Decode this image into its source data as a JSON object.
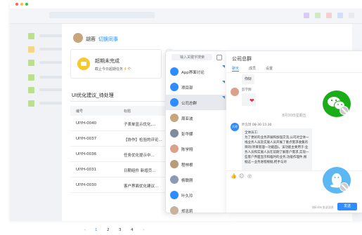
{
  "user": {
    "name": "胡蓉",
    "switch_label": "切换同事"
  },
  "task_card": {
    "title": "超期未完成",
    "subtitle_prefix": "截止今日超期任务",
    "count": "4",
    "subtitle_suffix": "个"
  },
  "section": {
    "title": "UI优化建议_待处理"
  },
  "table": {
    "headers": [
      "编号",
      "标题"
    ],
    "rows": [
      {
        "id": "UIYH-0040",
        "title": "子表单显示优化,..."
      },
      {
        "id": "UIYH-0037",
        "title": "【协作】检验的评论..."
      },
      {
        "id": "UIYH-0036",
        "title": "任务优化提示中..."
      },
      {
        "id": "UIYH-0031",
        "title": "日期组件 新增页..."
      },
      {
        "id": "UIYH-0030",
        "title": "客户界面优化建议..."
      }
    ]
  },
  "pager": {
    "pages": [
      "1",
      "2",
      "3",
      "4"
    ]
  },
  "contacts": {
    "search_placeholder": "输入关键字搜索",
    "items": [
      {
        "name": "App界面讨论",
        "color": "#2f8cff"
      },
      {
        "name": "项目部",
        "color": "#2f8cff"
      },
      {
        "name": "公司总群",
        "color": "#2f8cff"
      },
      {
        "name": "周亚波",
        "color": "#c9a57b"
      },
      {
        "name": "彭华娜",
        "color": "#7f8c9b"
      },
      {
        "name": "陈学翔",
        "color": "#d9a28a"
      },
      {
        "name": "程林根",
        "color": "#b89b7a"
      },
      {
        "name": "杨联刚",
        "color": "#8a9bb3"
      },
      {
        "name": "叶久玲",
        "color": "#2f8cff"
      },
      {
        "name": "郑忠莉",
        "color": "#c7b39c"
      }
    ]
  },
  "chat": {
    "title": "公司总群",
    "tabs": [
      "聊天",
      "成员",
      "设置"
    ],
    "msg_hello": "你好",
    "sender2": "彭学翔",
    "time_separator": "8月30日星期五",
    "sender3": "叶久玲 08-30 15:30",
    "sender3_avatar_label": "久玲",
    "long_msg": "全体员工:\n为了更好的业务开展和加强交流,公司对全体一线业务人员及实施人员开展了重点需求收集的目的(项目管理一功能面)。该功能主要用于:业务人员和实施人员在前期了解客户需求,实现一些客户界面显示和临时的业务,功能作理件,根据这一业务进程根据,把手与对",
    "send_hint": "按Enter发送消息",
    "send_label": "发送"
  },
  "colors": {
    "accent": "#2f8cff",
    "wechat": "#1aad19",
    "qq": "#5bb8f5",
    "warning": "#f8c82e"
  }
}
